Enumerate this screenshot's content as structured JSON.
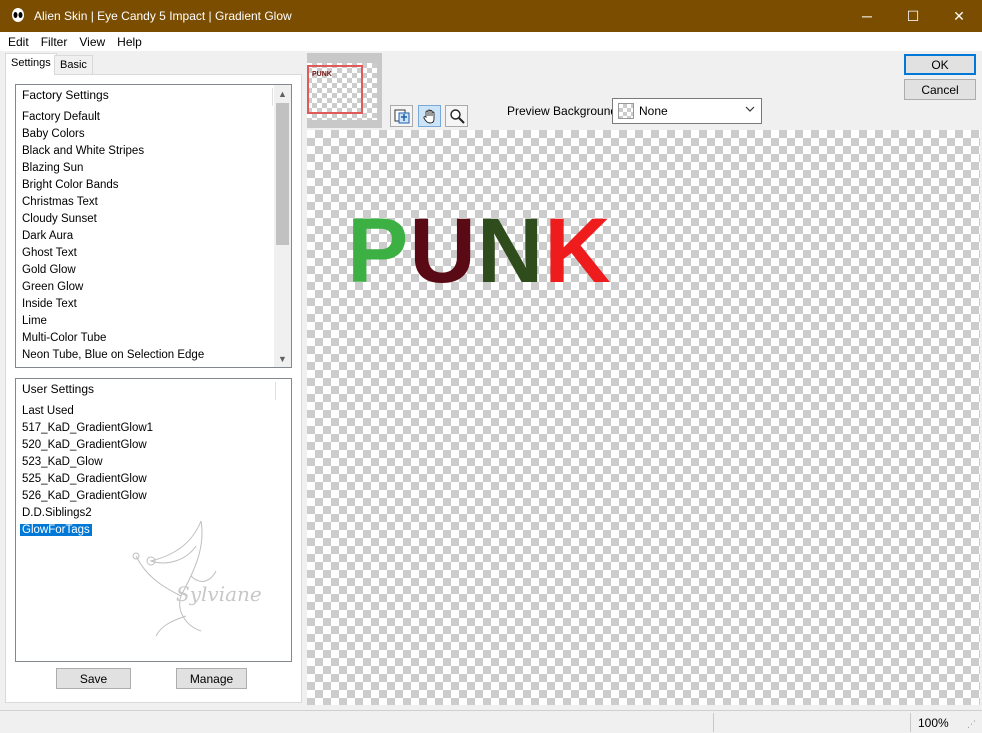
{
  "window": {
    "title": "Alien Skin | Eye Candy 5 Impact | Gradient Glow",
    "minimize": "─",
    "maximize": "☐",
    "close": "✕"
  },
  "menu": [
    "Edit",
    "Filter",
    "View",
    "Help"
  ],
  "tabs": [
    "Settings",
    "Basic"
  ],
  "factory": {
    "header": "Factory Settings",
    "items": [
      "Factory Default",
      "Baby Colors",
      "Black and White Stripes",
      "Blazing Sun",
      "Bright Color Bands",
      "Christmas Text",
      "Cloudy Sunset",
      "Dark Aura",
      "Ghost Text",
      "Gold Glow",
      "Green Glow",
      "Inside Text",
      "Lime",
      "Multi-Color Tube",
      "Neon Tube, Blue on Selection Edge"
    ]
  },
  "user": {
    "header": "User Settings",
    "items": [
      "Last Used",
      "517_KaD_GradientGlow1",
      "520_KaD_GradientGlow",
      "523_KaD_Glow",
      "525_KaD_GradientGlow",
      "526_KaD_GradientGlow",
      "D.D.Siblings2",
      "GlowForTags"
    ],
    "selected_index": 7
  },
  "buttons": {
    "save": "Save",
    "manage": "Manage",
    "ok": "OK",
    "cancel": "Cancel"
  },
  "thumbnail": {
    "text": "PUNK"
  },
  "preview_background": {
    "label": "Preview Background:",
    "value": "None"
  },
  "preview": {
    "letters": [
      {
        "char": "P",
        "color": "#3cb043"
      },
      {
        "char": "U",
        "color": "#5a0a14"
      },
      {
        "char": "N",
        "color": "#2f4d1c"
      },
      {
        "char": "K",
        "color": "#ee1c1c"
      }
    ]
  },
  "watermark": {
    "text": "Sylviane"
  },
  "status": {
    "zoom": "100%"
  },
  "icons": [
    "alien-skin-logo-icon",
    "before-after-icon",
    "hand-pan-icon",
    "zoom-magnifier-icon"
  ]
}
